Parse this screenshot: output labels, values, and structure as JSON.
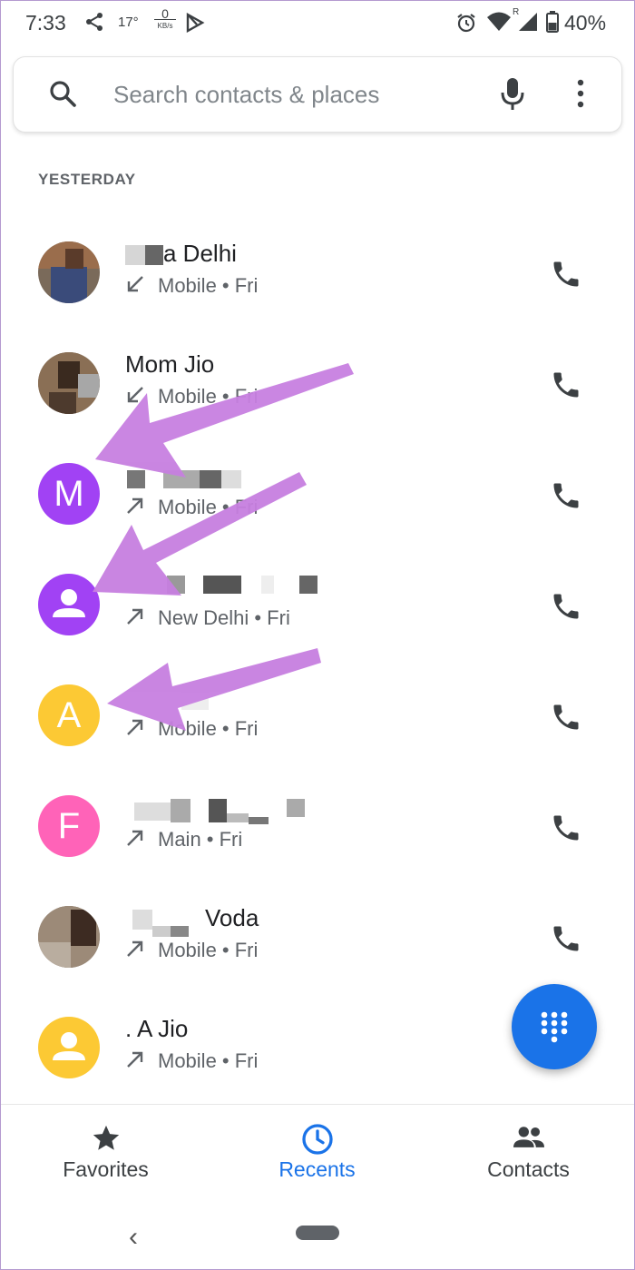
{
  "status_bar": {
    "time": "7:33",
    "temperature": "17°",
    "speed_value": "0",
    "speed_unit": "KB/s",
    "network_label": "R",
    "battery": "40%"
  },
  "search": {
    "placeholder": "Search contacts & places"
  },
  "section_header": "YESTERDAY",
  "colors": {
    "accent": "#1a73e8",
    "annotation_arrow": "#c77fe0",
    "avatar_purple": "#a142f4",
    "avatar_yellow": "#fcc934",
    "avatar_pink": "#ff63b8"
  },
  "calls": [
    {
      "name": "a Delhi",
      "direction": "incoming",
      "detail": "Mobile • Fri",
      "avatar": "photo"
    },
    {
      "name": "Mom Jio",
      "direction": "incoming",
      "detail": "Mobile • Fri",
      "avatar": "photo"
    },
    {
      "name": "",
      "direction": "outgoing",
      "detail": "Mobile • Fri",
      "avatar": "M"
    },
    {
      "name": "",
      "direction": "outgoing",
      "detail": "New Delhi • Fri",
      "avatar": "person-icon"
    },
    {
      "name": "",
      "direction": "outgoing",
      "detail": "Mobile • Fri",
      "avatar": "A"
    },
    {
      "name": "",
      "direction": "outgoing",
      "detail": "Main • Fri",
      "avatar": "F"
    },
    {
      "name": "Voda",
      "direction": "outgoing",
      "detail": "Mobile • Fri",
      "avatar": "photo"
    },
    {
      "name": ". A Jio",
      "direction": "outgoing",
      "detail": "Mobile • Fri",
      "avatar": "person-icon"
    }
  ],
  "nav": {
    "favorites": "Favorites",
    "recents": "Recents",
    "contacts": "Contacts"
  },
  "icons": {
    "search": "search-icon",
    "mic": "mic-icon",
    "more": "more-vert-icon",
    "call": "phone-icon",
    "dialpad": "dialpad-icon",
    "favorites": "star-icon",
    "recents": "clock-icon",
    "contacts": "people-icon"
  }
}
